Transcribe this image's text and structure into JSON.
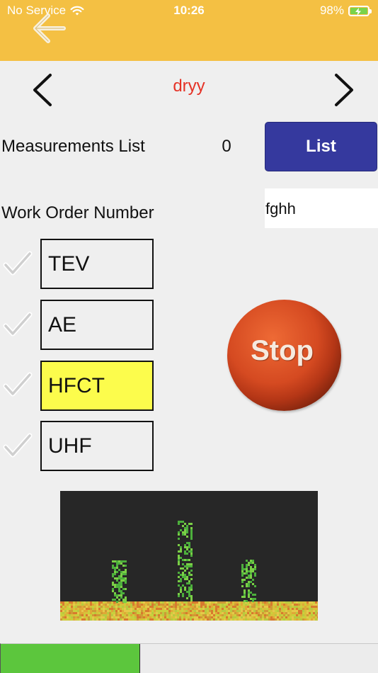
{
  "status_bar": {
    "carrier": "No Service",
    "time": "10:26",
    "battery": "98%"
  },
  "header": {
    "back_icon": "back-arrow-icon"
  },
  "nav": {
    "title": "dryy",
    "prev_icon": "chevron-left-icon",
    "next_icon": "chevron-right-icon"
  },
  "measurements": {
    "label": "Measurements List",
    "count": "0",
    "list_button": "List"
  },
  "work_order": {
    "label": "Work Order Number",
    "value": "fghh"
  },
  "sensors": [
    {
      "label": "TEV",
      "checked": false,
      "active": false
    },
    {
      "label": "AE",
      "checked": false,
      "active": false
    },
    {
      "label": "HFCT",
      "checked": false,
      "active": true
    },
    {
      "label": "UHF",
      "checked": false,
      "active": false
    }
  ],
  "stop_button": {
    "label": "Stop"
  },
  "colors": {
    "header": "#f4c043",
    "title": "#e53226",
    "list_button": "#35399e",
    "active_sensor": "#fcfc4c",
    "progress": "#5cc63d"
  },
  "progress": {
    "fraction": 0.37
  }
}
